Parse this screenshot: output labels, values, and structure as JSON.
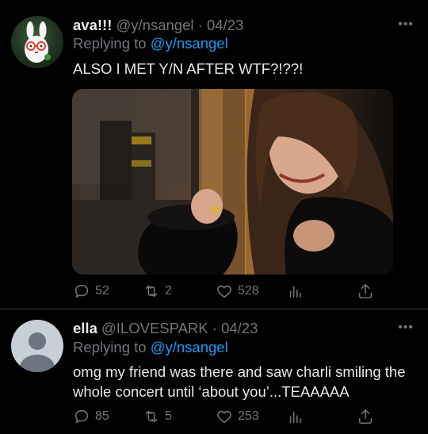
{
  "tweets": [
    {
      "name": "ava!!!",
      "handle": "@y/nsangel",
      "date": "04/23",
      "replying_label": "Replying to",
      "replying_to": "@y/nsangel",
      "text": "ALSO I MET Y/N AFTER WTF?!??!",
      "more": "•••",
      "has_media": true,
      "stats": {
        "replies": "52",
        "retweets": "2",
        "likes": "528"
      }
    },
    {
      "name": "ella",
      "handle": "@ILOVESPARK",
      "date": "04/23",
      "replying_label": "Replying to",
      "replying_to": "@y/nsangel",
      "text": "omg my friend was there and saw charli smiling the whole concert until ‘about you’...TEAAAAA",
      "more": "•••",
      "has_media": false,
      "stats": {
        "replies": "85",
        "retweets": "5",
        "likes": "253"
      }
    }
  ],
  "colors": {
    "background": "#000000",
    "text": "#e7e9ea",
    "muted": "#71767b",
    "link": "#1d9bf0",
    "divider": "#2f3336"
  },
  "icons": [
    "reply-icon",
    "retweet-icon",
    "like-icon",
    "views-icon",
    "share-icon",
    "more-icon"
  ]
}
